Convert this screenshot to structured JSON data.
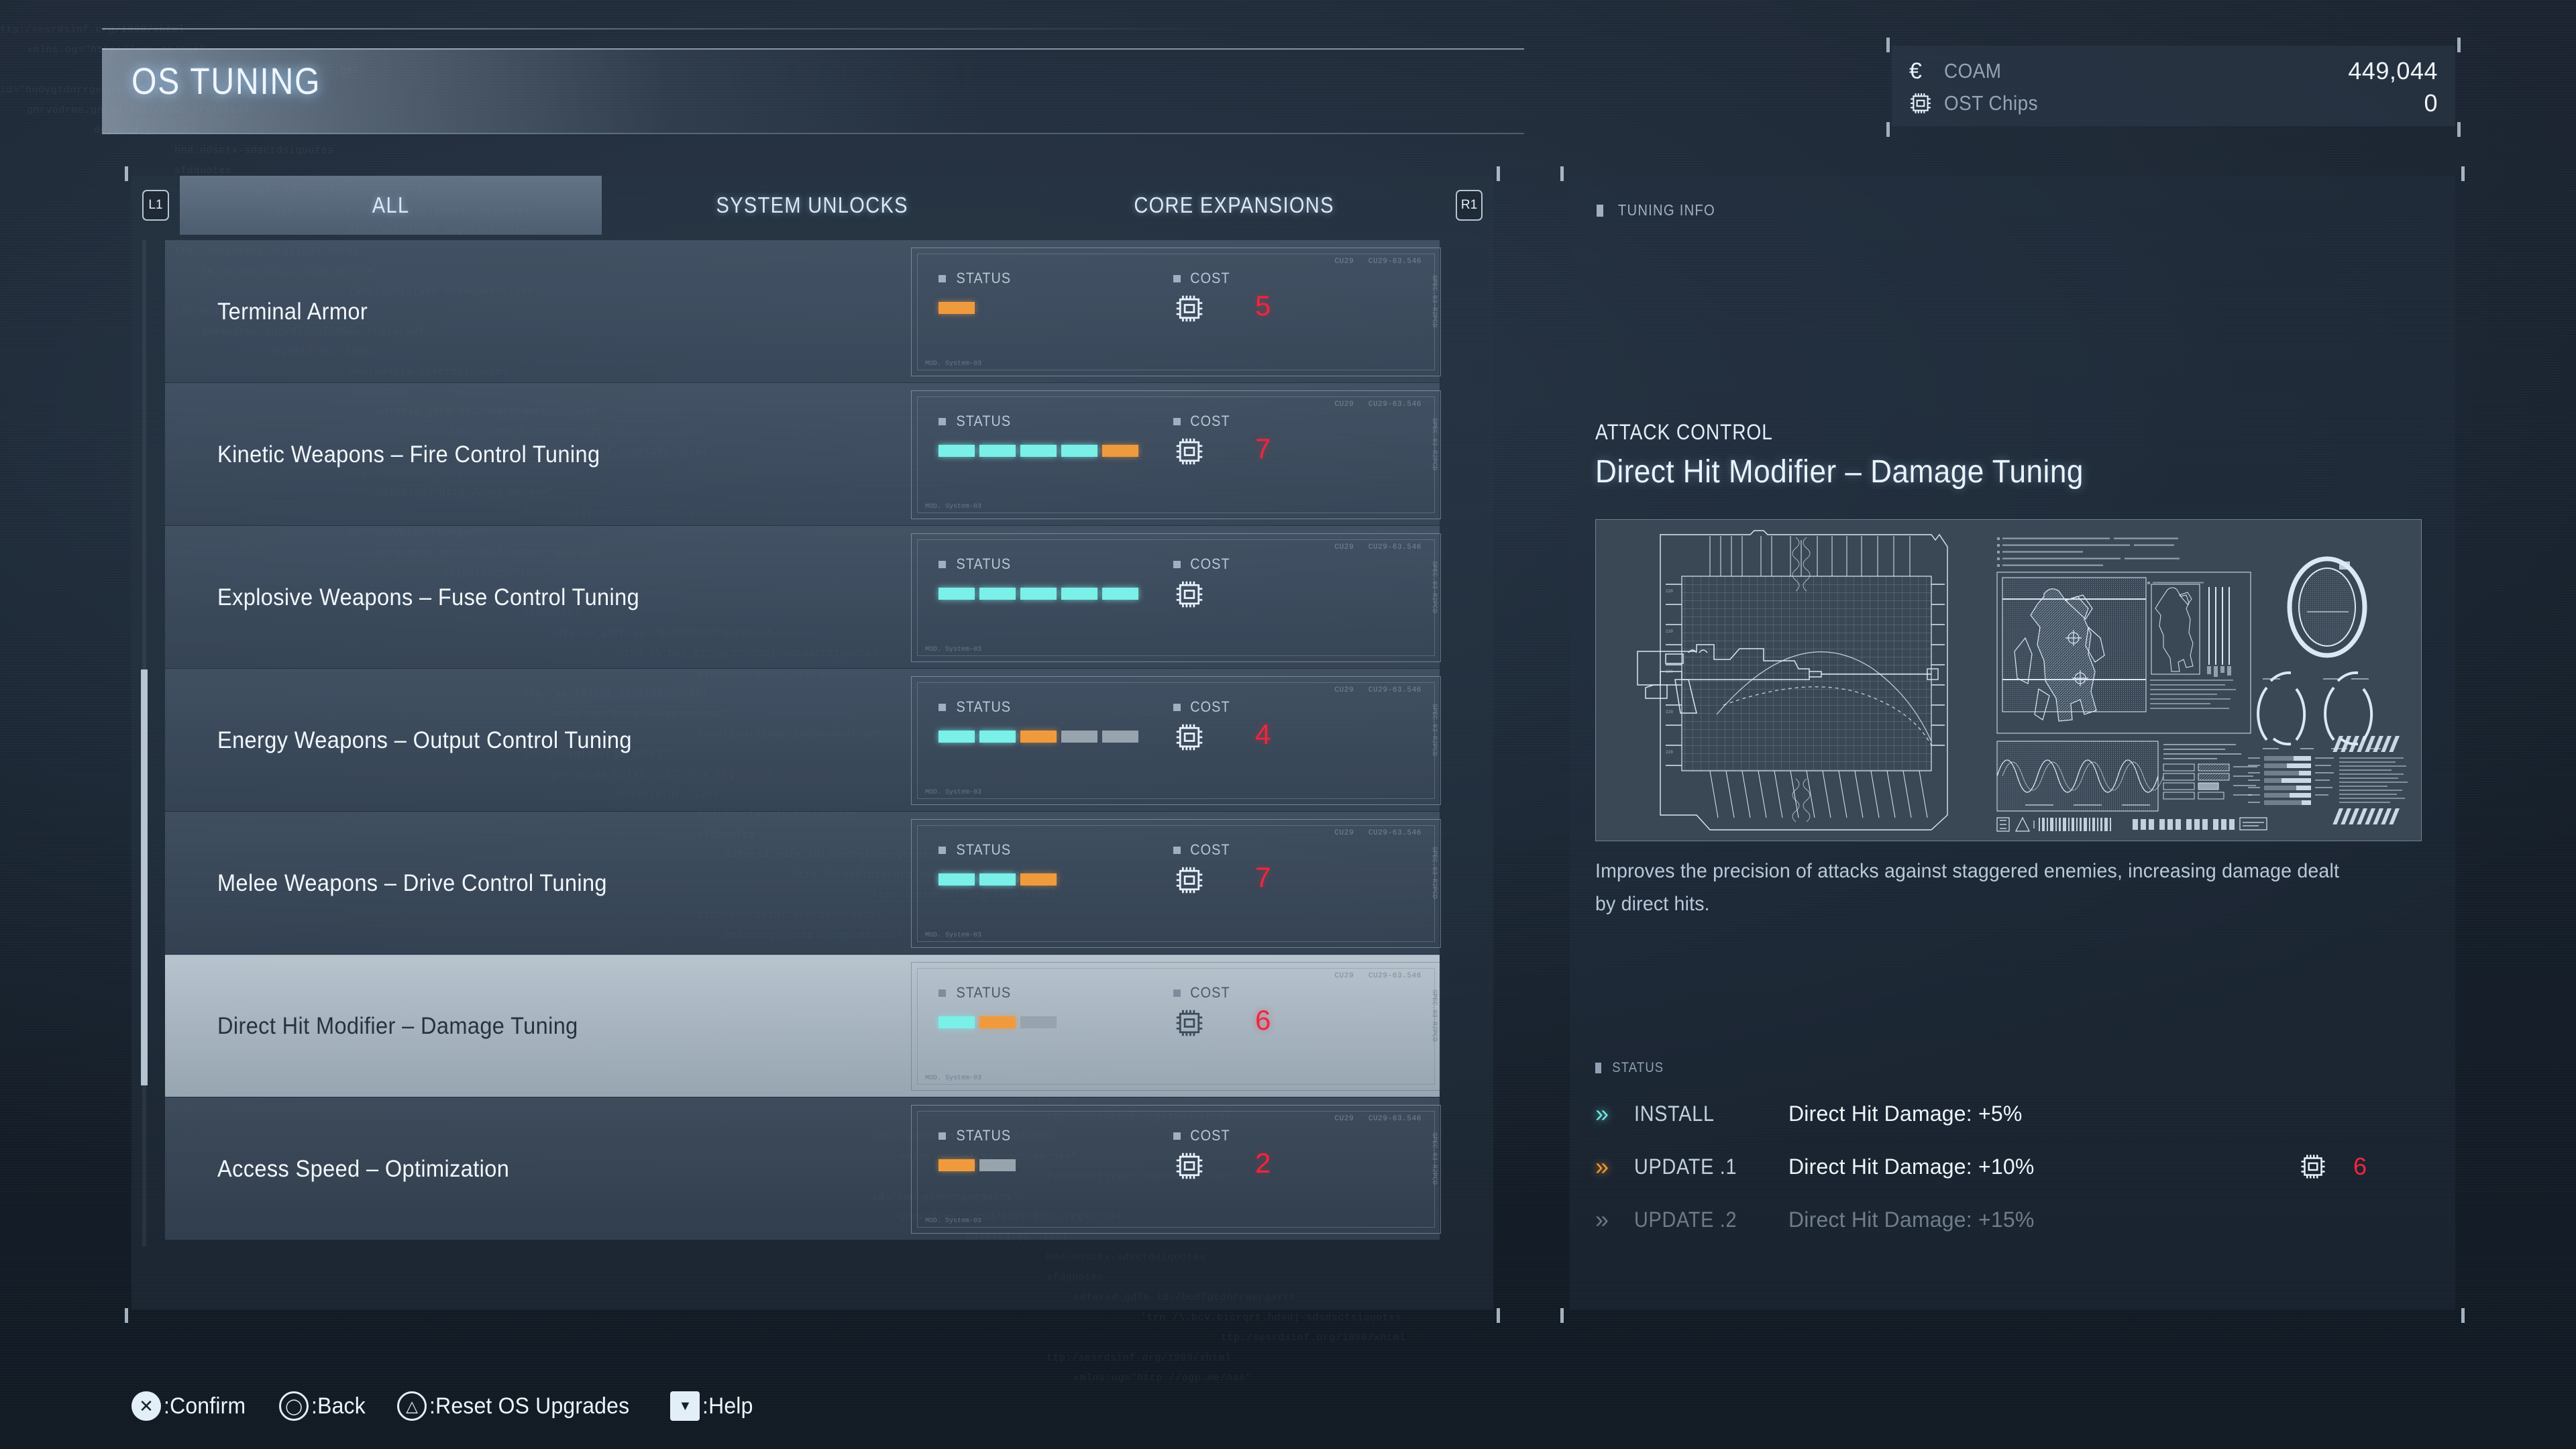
{
  "header": {
    "title": "OS TUNING"
  },
  "currency": {
    "rows": [
      {
        "icon": "euro-icon",
        "label": "COAM",
        "value": "449,044"
      },
      {
        "icon": "ost-chip-icon",
        "label": "OST Chips",
        "value": "0"
      }
    ]
  },
  "tabs": {
    "left_bumper": "L1",
    "right_bumper": "R1",
    "items": [
      {
        "label": "ALL",
        "active": true
      },
      {
        "label": "SYSTEM UNLOCKS",
        "active": false
      },
      {
        "label": "CORE EXPANSIONS",
        "active": false
      }
    ]
  },
  "list": {
    "status_label": "STATUS",
    "cost_label": "COST",
    "panel_code": "CU29-63.546",
    "panel_code_small": "CU29",
    "panel_vcode": "SPEC.03-R2PCD",
    "panel_code_corner": "MOD.  System-03",
    "items": [
      {
        "name": "Terminal Armor",
        "segments": [
          "og"
        ],
        "cost": "5",
        "selected": false
      },
      {
        "name": "Kinetic Weapons – Fire Control Tuning",
        "segments": [
          "cy",
          "cy",
          "cy",
          "cy",
          "og"
        ],
        "cost": "7",
        "selected": false
      },
      {
        "name": "Explosive Weapons – Fuse Control Tuning",
        "segments": [
          "cy",
          "cy",
          "cy",
          "cy",
          "cy"
        ],
        "cost": "",
        "selected": false
      },
      {
        "name": "Energy Weapons – Output Control Tuning",
        "segments": [
          "cy",
          "cy",
          "og",
          "gy",
          "gy"
        ],
        "cost": "4",
        "selected": false
      },
      {
        "name": "Melee Weapons – Drive Control Tuning",
        "segments": [
          "cy",
          "cy",
          "og"
        ],
        "cost": "7",
        "selected": false
      },
      {
        "name": "Direct Hit Modifier – Damage Tuning",
        "segments": [
          "cy",
          "og",
          "gy"
        ],
        "cost": "6",
        "selected": true
      },
      {
        "name": "Access Speed – Optimization",
        "segments": [
          "og",
          "gy"
        ],
        "cost": "2",
        "selected": false
      }
    ]
  },
  "detail": {
    "panel_label": "TUNING INFO",
    "category": "ATTACK CONTROL",
    "title": "Direct Hit Modifier – Damage Tuning",
    "description": "Improves the precision of attacks against staggered enemies, increasing damage dealt by direct hits.",
    "status_label": "STATUS",
    "upgrades": [
      {
        "name": "INSTALL",
        "effect": "Direct Hit Damage: +5%",
        "state": "installed",
        "chevron_color": "cy",
        "cost": ""
      },
      {
        "name": "UPDATE .1",
        "effect": "Direct Hit Damage: +10%",
        "state": "available",
        "chevron_color": "og",
        "cost": "6"
      },
      {
        "name": "UPDATE .2",
        "effect": "Direct Hit Damage: +15%",
        "state": "locked",
        "chevron_color": "gy",
        "cost": ""
      }
    ]
  },
  "hints": [
    {
      "button": "cross-button",
      "label": ":Confirm"
    },
    {
      "button": "circle-button",
      "label": ":Back"
    },
    {
      "button": "triangle-button",
      "label": ":Reset OS Upgrades"
    },
    {
      "button": "dpad-down-button",
      "label": ":Help"
    }
  ],
  "colors": {
    "segment_filled": "#7af0e8",
    "segment_next": "#f09a3e",
    "segment_empty": "#97a3ad",
    "cost_number": "#f0263c",
    "accent_text": "#eaf3fc"
  }
}
